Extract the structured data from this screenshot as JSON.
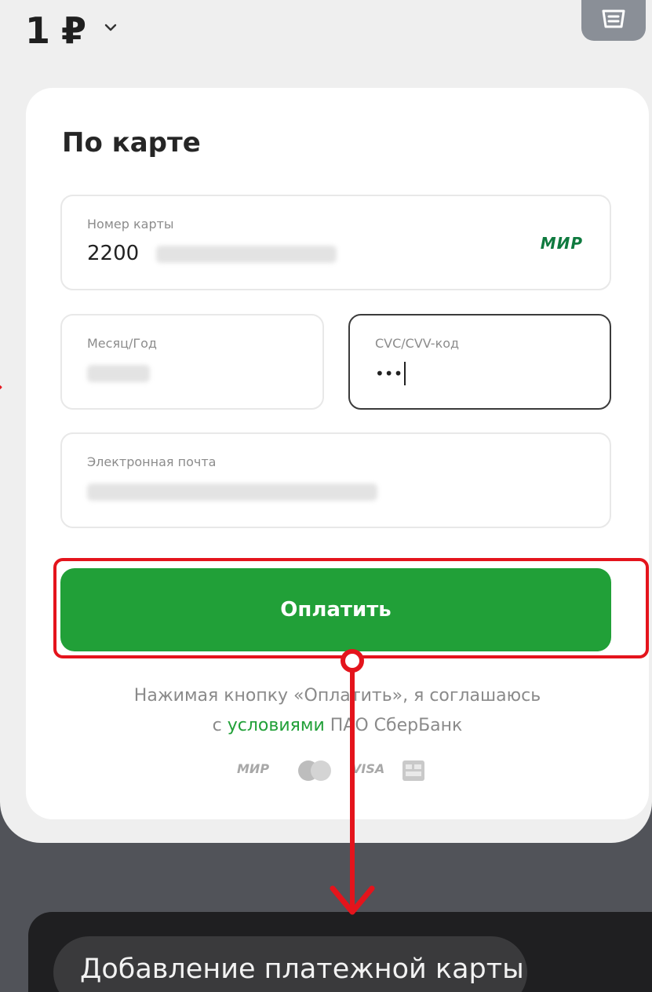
{
  "header": {
    "amount": "1 ₽",
    "chevron_icon": "chevron-down-icon",
    "cart_icon": "basket-icon"
  },
  "payment_form": {
    "title": "По карте",
    "card_number": {
      "label": "Номер карты",
      "value_visible": "2200",
      "brand_logo": "МИР"
    },
    "expiry": {
      "label": "Месяц/Год"
    },
    "cvc": {
      "label": "CVC/CVV-код",
      "value": "•••"
    },
    "email": {
      "label": "Электронная почта"
    },
    "pay_button_label": "Оплатить",
    "consent_line1": "Нажимая кнопку «Оплатить», я соглашаюсь",
    "consent_prefix": "с ",
    "consent_link": "условиями",
    "consent_suffix": " ПАО СберБанк",
    "payment_systems": {
      "mir": "МИР",
      "visa": "VISA"
    }
  },
  "annotation": {
    "color": "#e4141c"
  },
  "bottom_sheet": {
    "chip_label": "Добавление платежной карты"
  },
  "colors": {
    "accent_green": "#21a038",
    "mir_green": "#0f7a3f",
    "annotation_red": "#e4141c"
  }
}
